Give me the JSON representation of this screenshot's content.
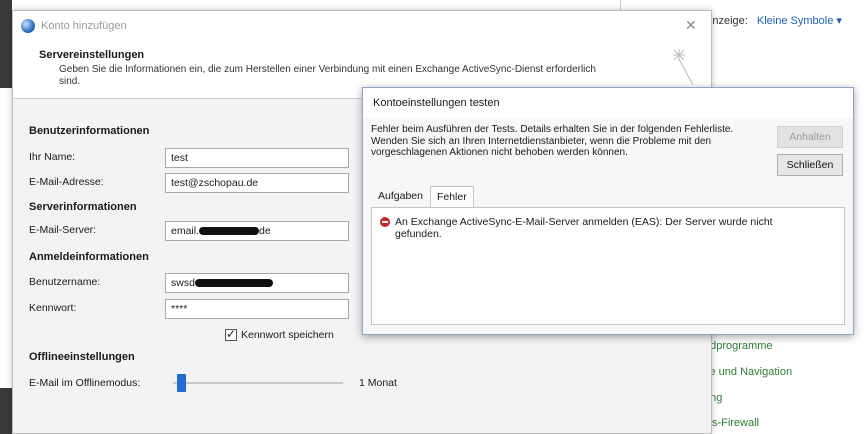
{
  "background": {
    "anzeige_label": "Anzeige:",
    "anzeige_value": "Kleine Symbole ▾",
    "links": [
      "ndprogramme",
      "ite und Navigation",
      "ung",
      "ws-Firewall"
    ]
  },
  "dialog": {
    "title": "Konto hinzufügen",
    "close_icon": "close-icon",
    "header_title": "Servereinstellungen",
    "header_sub": "Geben Sie die Informationen ein, die zum Herstellen einer Verbindung mit einen Exchange ActiveSync-Dienst erforderlich sind.",
    "sections": {
      "user": "Benutzerinformationen",
      "server": "Serverinformationen",
      "login": "Anmeldeinformationen",
      "offline": "Offlineeinstellungen"
    },
    "fields": {
      "name_label": "Ihr Name:",
      "name_value": "test",
      "email_label": "E-Mail-Adresse:",
      "email_value": "test@zschopau.de",
      "server_label": "E-Mail-Server:",
      "server_prefix": "email.",
      "server_suffix": "de",
      "username_label": "Benutzername:",
      "username_prefix": "swsd",
      "password_label": "Kennwort:",
      "password_value": "****"
    },
    "save_password_label": "Kennwort speichern",
    "offline_label": "E-Mail im Offlinemodus:",
    "offline_value": "1 Monat",
    "offline_slider_fraction": 0.0
  },
  "test_dialog": {
    "title": "Kontoeinstellungen testen",
    "message": "Fehler beim Ausführen der Tests. Details erhalten Sie in der folgenden Fehlerliste. Wenden Sie sich an Ihren Internetdienstanbieter, wenn die Probleme mit den vorgeschlagenen Aktionen nicht behoben werden können.",
    "stop_button": "Anhalten",
    "close_button": "Schließen",
    "tabs": [
      "Aufgaben",
      "Fehler"
    ],
    "active_tab": "Fehler",
    "error_text": "An Exchange ActiveSync-E-Mail-Server anmelden (EAS): Der Server wurde nicht gefunden."
  }
}
